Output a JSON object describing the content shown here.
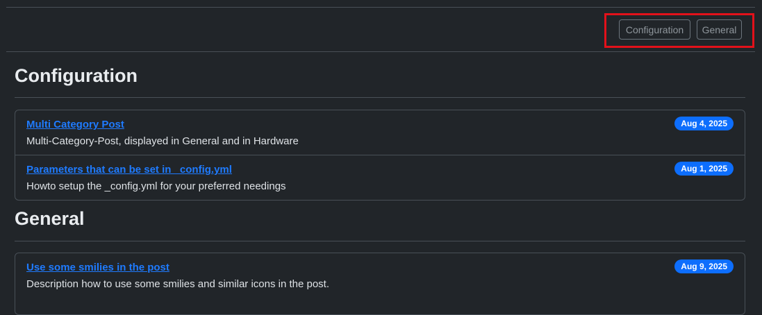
{
  "filters": {
    "configuration_label": "Configuration",
    "general_label": "General"
  },
  "sections": [
    {
      "title": "Configuration",
      "posts": [
        {
          "title": "Multi Category Post",
          "description": "Multi-Category-Post, displayed in General and in Hardware",
          "date": "Aug 4, 2025"
        },
        {
          "title": "Parameters that can be set in _config.yml",
          "description": "Howto setup the _config.yml for your preferred needings",
          "date": "Aug 1, 2025"
        }
      ]
    },
    {
      "title": "General",
      "posts": [
        {
          "title": "Use some smilies in the post",
          "description": "Description how to use some smilies and similar icons in the post.",
          "date": "Aug 9, 2025"
        }
      ]
    }
  ],
  "colors": {
    "background": "#212529",
    "link": "#1f7bff",
    "badge": "#0d6efd",
    "highlight": "#e3111a"
  }
}
